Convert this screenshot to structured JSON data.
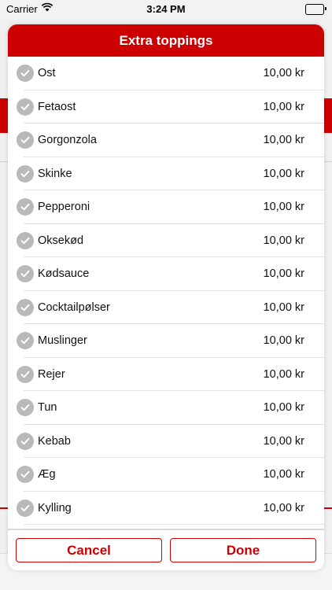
{
  "status_bar": {
    "carrier": "Carrier",
    "time": "3:24 PM"
  },
  "modal": {
    "title": "Extra toppings",
    "accent_color": "#cc0000",
    "items": [
      {
        "name": "Ost",
        "price": "10,00 kr"
      },
      {
        "name": "Fetaost",
        "price": "10,00 kr"
      },
      {
        "name": "Gorgonzola",
        "price": "10,00 kr"
      },
      {
        "name": "Skinke",
        "price": "10,00 kr"
      },
      {
        "name": "Pepperoni",
        "price": "10,00 kr"
      },
      {
        "name": "Oksekød",
        "price": "10,00 kr"
      },
      {
        "name": "Kødsauce",
        "price": "10,00 kr"
      },
      {
        "name": "Cocktailpølser",
        "price": "10,00 kr"
      },
      {
        "name": "Muslinger",
        "price": "10,00 kr"
      },
      {
        "name": "Rejer",
        "price": "10,00 kr"
      },
      {
        "name": "Tun",
        "price": "10,00 kr"
      },
      {
        "name": "Kebab",
        "price": "10,00 kr"
      },
      {
        "name": "Æg",
        "price": "10,00 kr"
      },
      {
        "name": "Kylling",
        "price": "10,00 kr"
      }
    ],
    "cancel_label": "Cancel",
    "done_label": "Done"
  }
}
